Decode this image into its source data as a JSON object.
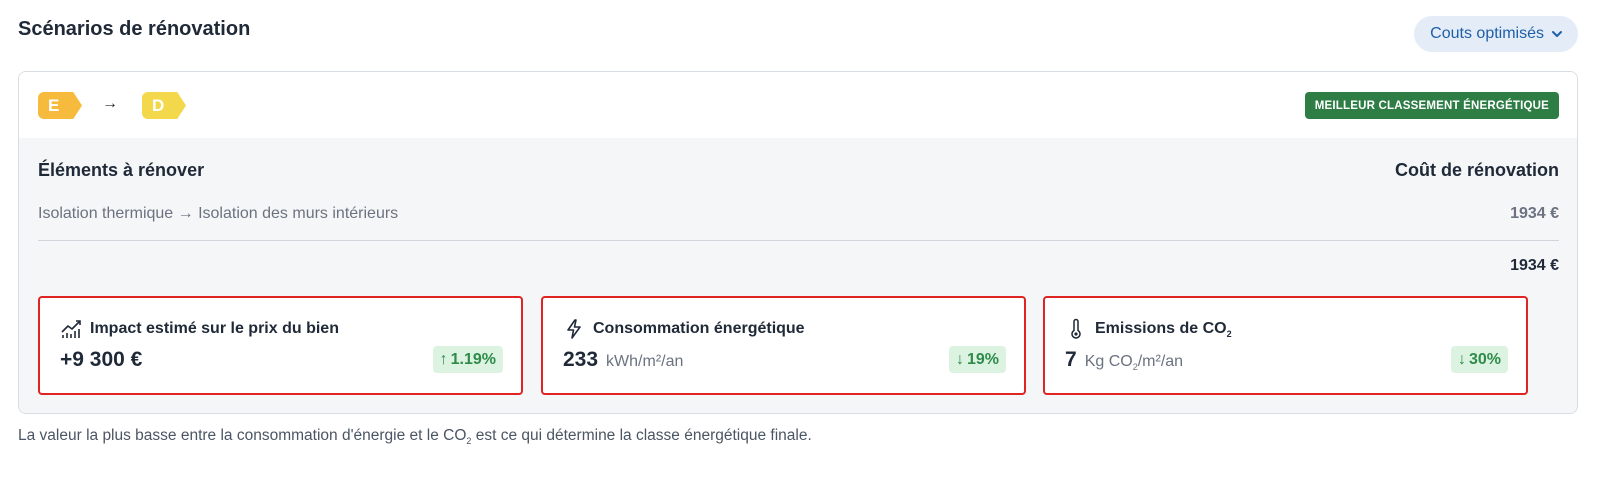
{
  "header": {
    "title": "Scénarios de rénovation",
    "sort_label": "Couts optimisés",
    "sort_icon": "chevron-down-icon"
  },
  "scenario": {
    "from_class": "E",
    "to_class": "D",
    "arrow": "→",
    "from_color": "#f6bb3c",
    "to_color": "#f2d84a",
    "tag": "MEILLEUR CLASSEMENT ÉNERGÉTIQUE",
    "tag_color": "#2e7d45"
  },
  "renovation": {
    "elements_header": "Éléments à rénover",
    "cost_header": "Coût de rénovation",
    "items": [
      {
        "label": "Isolation thermique → Isolation des murs intérieurs",
        "cost": "1934 €"
      }
    ],
    "total": "1934 €"
  },
  "metrics": [
    {
      "icon": "chart-trend-icon",
      "title": "Impact estimé sur le prix du bien",
      "value": "+9 300 €",
      "unit": "",
      "change": "1.19%",
      "direction": "up"
    },
    {
      "icon": "lightning-icon",
      "title": "Consommation énergétique",
      "value": "233",
      "unit": "kWh/m²/an",
      "change": "19%",
      "direction": "down"
    },
    {
      "icon": "thermometer-icon",
      "title_prefix": "Emissions de CO",
      "title_sub": "2",
      "value": "7",
      "unit_prefix": "Kg CO",
      "unit_sub": "2",
      "unit_suffix": "/m²/an",
      "change": "30%",
      "direction": "down"
    }
  ],
  "footnote": {
    "before": "La valeur la plus basse entre la consommation d'énergie et le CO",
    "sub": "2",
    "after": " est ce qui détermine la classe énergétique finale."
  },
  "colors": {
    "highlight_border": "#e02424",
    "positive_bg": "#dcf3e1",
    "positive_text": "#2e8b4a"
  }
}
